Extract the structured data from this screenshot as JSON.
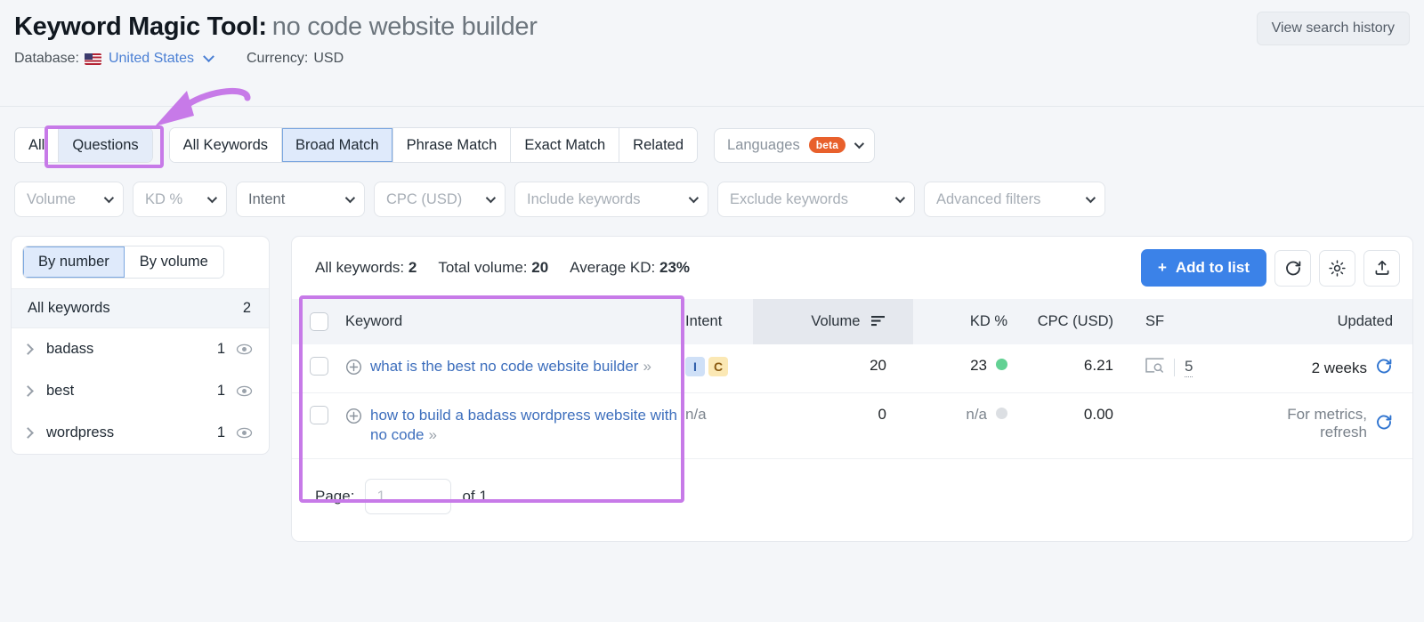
{
  "header": {
    "title": "Keyword Magic Tool:",
    "query": "no code website builder",
    "history_button": "View search history",
    "database_label": "Database:",
    "database_value": "United States",
    "currency_label": "Currency:",
    "currency_value": "USD"
  },
  "tabs": {
    "group1": [
      {
        "label": "All",
        "active": false
      },
      {
        "label": "Questions",
        "active": true
      }
    ],
    "group2": [
      {
        "label": "All Keywords",
        "active": false
      },
      {
        "label": "Broad Match",
        "active": true
      },
      {
        "label": "Phrase Match",
        "active": false
      },
      {
        "label": "Exact Match",
        "active": false
      },
      {
        "label": "Related",
        "active": false
      }
    ],
    "languages": {
      "label": "Languages",
      "badge": "beta"
    }
  },
  "filters": [
    {
      "label": "Volume",
      "muted": true
    },
    {
      "label": "KD %",
      "muted": true
    },
    {
      "label": "Intent",
      "muted": false
    },
    {
      "label": "CPC (USD)",
      "muted": true
    },
    {
      "label": "Include keywords",
      "muted": false
    },
    {
      "label": "Exclude keywords",
      "muted": false
    },
    {
      "label": "Advanced filters",
      "muted": false
    }
  ],
  "sidebar": {
    "toggle": [
      {
        "label": "By number",
        "active": true
      },
      {
        "label": "By volume",
        "active": false
      }
    ],
    "all_keywords_label": "All keywords",
    "all_keywords_count": "2",
    "groups": [
      {
        "label": "badass",
        "count": "1"
      },
      {
        "label": "best",
        "count": "1"
      },
      {
        "label": "wordpress",
        "count": "1"
      }
    ]
  },
  "toolbar": {
    "all_keywords_label": "All keywords:",
    "all_keywords_value": "2",
    "total_volume_label": "Total volume:",
    "total_volume_value": "20",
    "average_kd_label": "Average KD:",
    "average_kd_value": "23%",
    "add_to_list": "Add to list",
    "plus": "+"
  },
  "table": {
    "columns": {
      "keyword": "Keyword",
      "intent": "Intent",
      "volume": "Volume",
      "kd": "KD %",
      "cpc": "CPC (USD)",
      "sf": "SF",
      "updated": "Updated"
    },
    "rows": [
      {
        "keyword": "what is the best no code website builder",
        "intents": [
          {
            "letter": "I",
            "type": "i"
          },
          {
            "letter": "C",
            "type": "c"
          }
        ],
        "volume": "20",
        "kd": "23",
        "kd_color": "#62d193",
        "cpc": "6.21",
        "sf_count": "5",
        "sf_na": false,
        "updated": "2 weeks",
        "updated_muted": false
      },
      {
        "keyword": "how to build a badass wordpress website with no code",
        "intents": [],
        "intent_na": "n/a",
        "volume": "0",
        "kd": "n/a",
        "kd_color": "#dcdfe3",
        "cpc": "0.00",
        "sf_count": "",
        "sf_na": true,
        "updated": "For metrics, refresh",
        "updated_muted": true
      }
    ]
  },
  "pagination": {
    "page_label": "Page:",
    "page_value_placeholder": "1",
    "of_label": "of 1"
  },
  "colors": {
    "accent_blue": "#3b82e8",
    "annotation_purple": "#c77ae8",
    "beta_orange": "#e8602c",
    "kd_green": "#62d193"
  }
}
